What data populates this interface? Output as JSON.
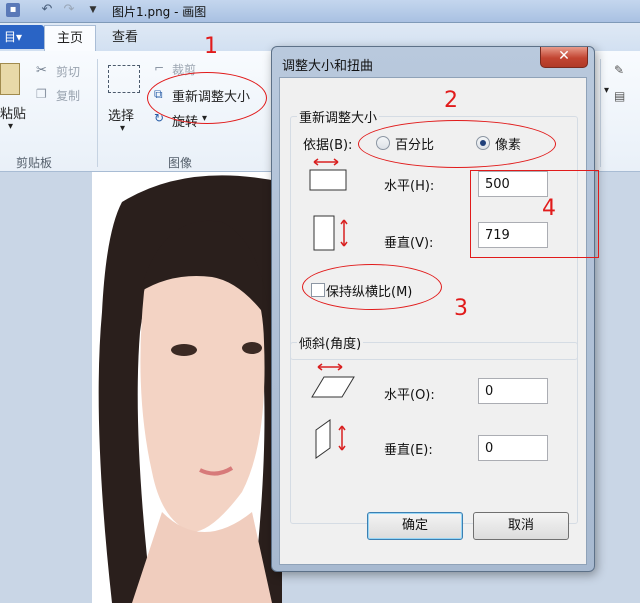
{
  "window": {
    "title": "图片1.png - 画图"
  },
  "ribbon": {
    "tabs": [
      "主页",
      "查看"
    ],
    "clipboard": {
      "paste": "粘贴",
      "cut": "剪切",
      "copy": "复制",
      "group": "剪贴板"
    },
    "image": {
      "select": "选择",
      "crop": "裁剪",
      "resize": "重新调整大小",
      "rotate": "旋转",
      "group": "图像"
    }
  },
  "dialog": {
    "title": "调整大小和扭曲",
    "resize_group": "重新调整大小",
    "by_label": "依据(B):",
    "percent_option": "百分比",
    "pixels_option": "像素",
    "selected_option": "像素",
    "horizontal_label": "水平(H):",
    "horizontal_value": "500",
    "vertical_label": "垂直(V):",
    "vertical_value": "719",
    "keep_aspect_label": "保持纵横比(M)",
    "keep_aspect_checked": false,
    "skew_group": "倾斜(角度)",
    "skew_horizontal_label": "水平(O):",
    "skew_horizontal_value": "0",
    "skew_vertical_label": "垂直(E):",
    "skew_vertical_value": "0",
    "ok": "确定",
    "cancel": "取消"
  },
  "annotations": {
    "n1": "1",
    "n2": "2",
    "n3": "3",
    "n4": "4",
    "color": "#e11b1b"
  }
}
